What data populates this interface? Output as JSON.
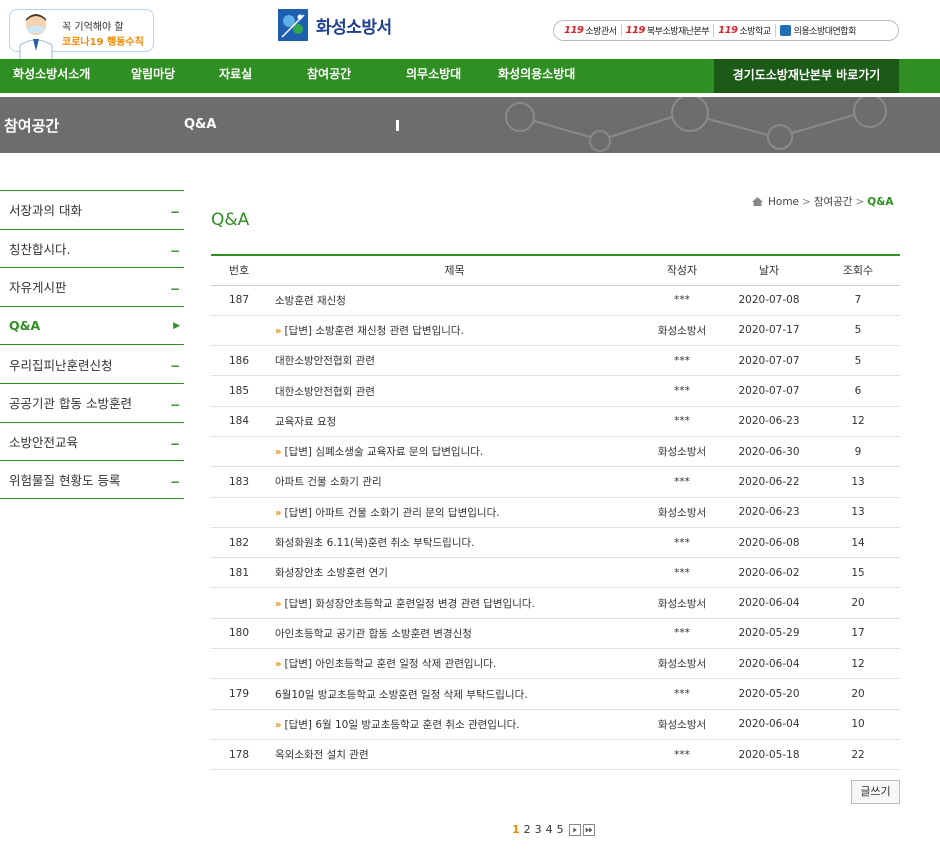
{
  "header": {
    "promo_line1": "꼭 기억해야 할",
    "promo_line2": "코로나19 행동수칙",
    "site_name": "화성소방서",
    "ext_links": [
      {
        "badge": "119",
        "label": "소방관서"
      },
      {
        "badge": "119",
        "label": "북부소방재난본부"
      },
      {
        "badge": "119",
        "label": "소방학교"
      },
      {
        "badge": "",
        "label": "의용소방대연합회"
      }
    ]
  },
  "gnb": {
    "items": [
      "화성소방서소개",
      "알림마당",
      "자료실",
      "참여공간",
      "의무소방대",
      "화성의용소방대"
    ],
    "shortcut": "경기도소방재난본부 바로가기"
  },
  "visual": {
    "section": "참여공간",
    "current": "Q&A"
  },
  "sidebar": {
    "items": [
      {
        "label": "서장과의 대화",
        "sign": "−"
      },
      {
        "label": "칭찬합시다.",
        "sign": "−"
      },
      {
        "label": "자유게시판",
        "sign": "−"
      },
      {
        "label": "Q&A",
        "sign": "▶"
      },
      {
        "label": "우리집피난훈련신청",
        "sign": "−"
      },
      {
        "label": "공공기관 합동 소방훈련",
        "sign": "−"
      },
      {
        "label": "소방안전교육",
        "sign": "−"
      },
      {
        "label": "위험물질 현황도 등록",
        "sign": "−"
      }
    ]
  },
  "breadcrumb": {
    "home": "Home",
    "section": "참여공간",
    "current": "Q&A"
  },
  "page_title": "Q&A",
  "board": {
    "headers": [
      "번호",
      "제목",
      "작성자",
      "날자",
      "조회수"
    ],
    "rows": [
      {
        "no": "187",
        "reply": false,
        "title": "소방훈련 재신청",
        "author": "***",
        "date": "2020-07-08",
        "views": "7"
      },
      {
        "no": "",
        "reply": true,
        "title": "[답변] 소방훈련 재신청 관련 답변입니다.",
        "author": "화성소방서",
        "date": "2020-07-17",
        "views": "5"
      },
      {
        "no": "186",
        "reply": false,
        "title": "대한소방안전협회 관련",
        "author": "***",
        "date": "2020-07-07",
        "views": "5"
      },
      {
        "no": "185",
        "reply": false,
        "title": "대한소방안전협회 관련",
        "author": "***",
        "date": "2020-07-07",
        "views": "6"
      },
      {
        "no": "184",
        "reply": false,
        "title": "교육자료 요청",
        "author": "***",
        "date": "2020-06-23",
        "views": "12"
      },
      {
        "no": "",
        "reply": true,
        "title": "[답변] 심폐소생술 교육자료 문의 답변입니다.",
        "author": "화성소방서",
        "date": "2020-06-30",
        "views": "9"
      },
      {
        "no": "183",
        "reply": false,
        "title": "아파트 건물 소화기 관리",
        "author": "***",
        "date": "2020-06-22",
        "views": "13"
      },
      {
        "no": "",
        "reply": true,
        "title": "[답변] 아파트 건물 소화기 관리 문의 답변입니다.",
        "author": "화성소방서",
        "date": "2020-06-23",
        "views": "13"
      },
      {
        "no": "182",
        "reply": false,
        "title": "화성화원초 6.11(목)훈련 취소 부탁드립니다.",
        "author": "***",
        "date": "2020-06-08",
        "views": "14"
      },
      {
        "no": "181",
        "reply": false,
        "title": "화성장안초 소방훈련 연기",
        "author": "***",
        "date": "2020-06-02",
        "views": "15"
      },
      {
        "no": "",
        "reply": true,
        "title": "[답변] 화성장안초등학교 훈련일정 변경 관련 답변입니다.",
        "author": "화성소방서",
        "date": "2020-06-04",
        "views": "20"
      },
      {
        "no": "180",
        "reply": false,
        "title": "아인초등학교 공기관 합동 소방훈련 변경신청",
        "author": "***",
        "date": "2020-05-29",
        "views": "17"
      },
      {
        "no": "",
        "reply": true,
        "title": "[답변] 아인초등학교 훈련 일정 삭제 관련입니다.",
        "author": "화성소방서",
        "date": "2020-06-04",
        "views": "12"
      },
      {
        "no": "179",
        "reply": false,
        "title": "6월10일 방교초등학교 소방훈련 일정 삭제 부탁드립니다.",
        "author": "***",
        "date": "2020-05-20",
        "views": "20"
      },
      {
        "no": "",
        "reply": true,
        "title": "[답변] 6월 10일 방교초등학교 훈련 취소 관련입니다.",
        "author": "화성소방서",
        "date": "2020-06-04",
        "views": "10"
      },
      {
        "no": "178",
        "reply": false,
        "title": "옥외소화전 설치 관련",
        "author": "***",
        "date": "2020-05-18",
        "views": "22"
      }
    ],
    "reply_marker": "»"
  },
  "write_button": "글쓰기",
  "paging": {
    "pages": [
      "1",
      "2",
      "3",
      "4",
      "5"
    ],
    "current": "1"
  },
  "colors": {
    "brand_green": "#2f8f22",
    "dark_green": "#1c5a18",
    "accent_orange": "#f08a00",
    "logo_blue": "#1f3f8f"
  }
}
